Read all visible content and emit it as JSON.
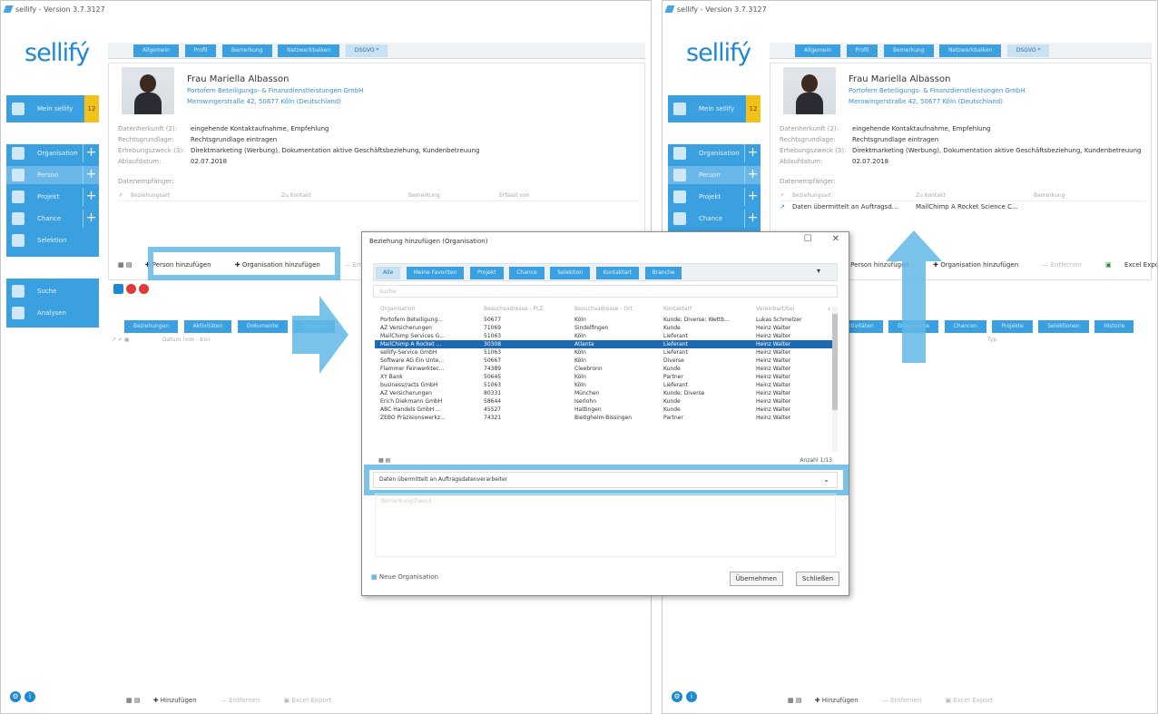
{
  "app": {
    "title": "sellify - Version 3.7.3127",
    "logo": "sellifý"
  },
  "sidebar": {
    "main_label": "Mein sellify",
    "badge": "12",
    "items": [
      "Organisation",
      "Person",
      "Projekt",
      "Chance",
      "Selektion"
    ],
    "tools": [
      "Suche",
      "Analysen"
    ]
  },
  "person": {
    "tabs": [
      "Allgemein",
      "Profil",
      "Bemerkung",
      "Netzwerkbalken",
      "DSGVO *"
    ],
    "name": "Frau Mariella Albasson",
    "company": "Portofem Beteiligungs- & Finanzdienstleistungen GmbH",
    "address": "Merowingerstraße 42, 50677 Köln (Deutschland)",
    "fields": [
      {
        "key": "Datenherkunft (2):",
        "value": "eingehende Kontaktaufnahme, Empfehlung"
      },
      {
        "key": "Rechtsgrundlage:",
        "value": "Rechtsgrundlage eintragen"
      },
      {
        "key": "Erhebungszweck (3):",
        "value": "Direktmarketing (Werbung), Dokumentation aktive Geschäftsbeziehung, Kundenbetreuung"
      },
      {
        "key": "Ablaufdatum:",
        "value": "02.07.2018"
      }
    ],
    "recipients_label": "Datenempfänger:",
    "recipient_cols": [
      "Beziehungsart",
      "Zu Kontakt",
      "Bemerkung",
      "Erfasst von"
    ],
    "recipient_row": {
      "type": "Daten übermittelt an Auftragsd...",
      "contact": "MailChimp A Rocket Science C..."
    },
    "toolbar": {
      "add_person": "Person hinzufügen",
      "add_org": "Organisation hinzufügen",
      "remove": "Entfernen",
      "excel": "Excel Export"
    }
  },
  "lower": {
    "tabs": [
      "Beziehungen",
      "Aktivitäten",
      "Dokumente",
      "Chancen",
      "Projekte",
      "Selektionen",
      "Historie"
    ],
    "cols": [
      "Datum (von - bis)",
      "Typ"
    ],
    "toolbar": {
      "add": "Hinzufügen",
      "remove": "Entfernen",
      "excel": "Excel Export"
    }
  },
  "dialog": {
    "title": "Beziehung hinzufügen (Organisation)",
    "tabs": [
      "Alle",
      "Meine Favoriten",
      "Projekt",
      "Chance",
      "Selektion",
      "Kontaktart",
      "Branche"
    ],
    "search_placeholder": "Suche",
    "columns": [
      "Organisation",
      "Besuchsadresse - PLZ",
      "Besuchsadresse - Ort",
      "Kontaktart",
      "Vereinbart/bei"
    ],
    "rows": [
      [
        "Portofem Beteiligung...",
        "50677",
        "Köln",
        "Kunde; Diverse; Wettb...",
        "Lukas Schmelzer"
      ],
      [
        "AZ Versicherungen",
        "71069",
        "Sindelfingen",
        "Kunde",
        "Heinz Walter"
      ],
      [
        "MailChimp Services G...",
        "51063",
        "Köln",
        "Lieferant",
        "Heinz Walter"
      ],
      [
        "MailChimp A Rocket ...",
        "30308",
        "Atlanta",
        "Lieferant",
        "Heinz Walter"
      ],
      [
        "sellify-Service GmbH",
        "51063",
        "Köln",
        "Lieferant",
        "Heinz Walter"
      ],
      [
        "Software AG Ein Unte...",
        "50667",
        "Köln",
        "Diverse",
        "Heinz Walter"
      ],
      [
        "Flammer Feinwerktec...",
        "74389",
        "Cleebronn",
        "Kunde",
        "Heinz Walter"
      ],
      [
        "XY Bank",
        "50645",
        "Köln",
        "Partner",
        "Heinz Walter"
      ],
      [
        "business//acts GmbH",
        "51063",
        "Köln",
        "Lieferant",
        "Heinz Walter"
      ],
      [
        "AZ Versicherungen",
        "80331",
        "München",
        "Kunde; Diverse",
        "Heinz Walter"
      ],
      [
        "Erich Diekmann GmbH",
        "58644",
        "Iserlohn",
        "Kunde",
        "Heinz Walter"
      ],
      [
        "ABC Handels GmbH ...",
        "45527",
        "Hattingen",
        "Kunde",
        "Heinz Walter"
      ],
      [
        "ZEBO Präzisionswerkz...",
        "74321",
        "Bietigheim-Bissingen",
        "Partner",
        "Heinz Walter"
      ]
    ],
    "count": "Anzahl 1/13",
    "relation": "Daten übermittelt an Auftragsdatenverarbeiter",
    "note_placeholder": "Bemerkung/Zweck",
    "new_org": "Neue Organisation",
    "apply": "Übernehmen",
    "close": "Schließen"
  }
}
